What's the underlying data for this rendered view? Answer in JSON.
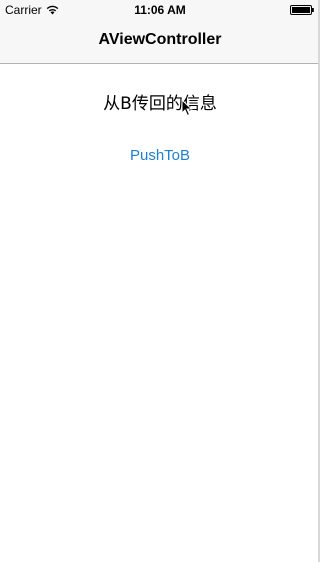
{
  "status_bar": {
    "carrier": "Carrier",
    "time": "11:06 AM",
    "wifi_icon": "wifi-icon",
    "battery_icon": "battery-icon"
  },
  "nav_bar": {
    "title": "AViewController"
  },
  "content": {
    "info_label": "从B传回的信息",
    "push_button_label": "PushToB"
  },
  "colors": {
    "accent": "#1a7fd6",
    "bar_background": "#f7f7f7",
    "separator": "#b2b2b2"
  }
}
